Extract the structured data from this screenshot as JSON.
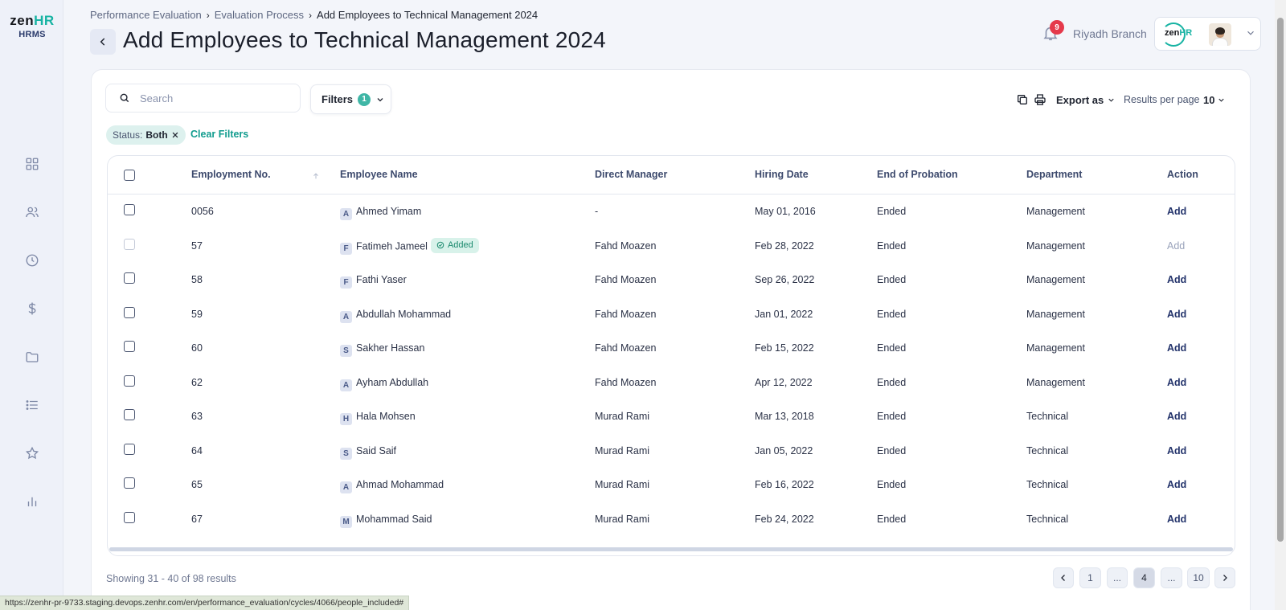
{
  "sidebar": {
    "logo_main": "zen",
    "logo_accent": "HR",
    "logo_sub": "HRMS",
    "nav_icons": [
      "dashboard-icon",
      "people-icon",
      "clock-icon",
      "dollar-icon",
      "folder-icon",
      "list-icon",
      "star-icon",
      "bar-chart-icon"
    ]
  },
  "header": {
    "breadcrumb": [
      "Performance Evaluation",
      "Evaluation Process",
      "Add Employees to Technical Management 2024"
    ],
    "title": "Add Employees to Technical Management 2024",
    "notification_count": "9",
    "branch": "Riyadh Branch",
    "company_logo_main": "zen",
    "company_logo_accent": "HR"
  },
  "toolbar": {
    "search_placeholder": "Search",
    "filters_label": "Filters",
    "filters_count": "1",
    "chip_label": "Status:",
    "chip_value": "Both",
    "clear_filters": "Clear Filters",
    "export_label": "Export as",
    "results_per_page_label": "Results per page",
    "results_per_page_value": "10"
  },
  "table": {
    "columns": [
      "Employment No.",
      "Employee Name",
      "Direct Manager",
      "Hiring Date",
      "End of Probation",
      "Department",
      "Action"
    ],
    "rows": [
      {
        "no": "0056",
        "initial": "A",
        "name": "Ahmed Yimam",
        "manager": "-",
        "hired": "May 01, 2016",
        "probation": "Ended",
        "dept": "Management",
        "action": "Add",
        "added": false
      },
      {
        "no": "57",
        "initial": "F",
        "name": "Fatimeh Jameel",
        "manager": "Fahd Moazen",
        "hired": "Feb 28, 2022",
        "probation": "Ended",
        "dept": "Management",
        "action": "Add",
        "added": true,
        "badge": "Added"
      },
      {
        "no": "58",
        "initial": "F",
        "name": "Fathi Yaser",
        "manager": "Fahd Moazen",
        "hired": "Sep 26, 2022",
        "probation": "Ended",
        "dept": "Management",
        "action": "Add",
        "added": false
      },
      {
        "no": "59",
        "initial": "A",
        "name": "Abdullah Mohammad",
        "manager": "Fahd Moazen",
        "hired": "Jan 01, 2022",
        "probation": "Ended",
        "dept": "Management",
        "action": "Add",
        "added": false
      },
      {
        "no": "60",
        "initial": "S",
        "name": "Sakher Hassan",
        "manager": "Fahd Moazen",
        "hired": "Feb 15, 2022",
        "probation": "Ended",
        "dept": "Management",
        "action": "Add",
        "added": false
      },
      {
        "no": "62",
        "initial": "A",
        "name": "Ayham Abdullah",
        "manager": "Fahd Moazen",
        "hired": "Apr 12, 2022",
        "probation": "Ended",
        "dept": "Management",
        "action": "Add",
        "added": false
      },
      {
        "no": "63",
        "initial": "H",
        "name": "Hala Mohsen",
        "manager": "Murad Rami",
        "hired": "Mar 13, 2018",
        "probation": "Ended",
        "dept": "Technical",
        "action": "Add",
        "added": false
      },
      {
        "no": "64",
        "initial": "S",
        "name": "Said Saif",
        "manager": "Murad Rami",
        "hired": "Jan 05, 2022",
        "probation": "Ended",
        "dept": "Technical",
        "action": "Add",
        "added": false
      },
      {
        "no": "65",
        "initial": "A",
        "name": "Ahmad Mohammad",
        "manager": "Murad Rami",
        "hired": "Feb 16, 2022",
        "probation": "Ended",
        "dept": "Technical",
        "action": "Add",
        "added": false
      },
      {
        "no": "67",
        "initial": "M",
        "name": "Mohammad Said",
        "manager": "Murad Rami",
        "hired": "Feb 24, 2022",
        "probation": "Ended",
        "dept": "Technical",
        "action": "Add",
        "added": false
      }
    ]
  },
  "footer": {
    "showing": "Showing 31 - 40 of 98 results",
    "pages": [
      "1",
      "...",
      "4",
      "...",
      "10"
    ],
    "current_page": "4"
  },
  "status_url": "https://zenhr-pr-9733.staging.devops.zenhr.com/en/performance_evaluation/cycles/4066/people_included#",
  "colors": {
    "accent": "#17b3a3",
    "primary_text": "#23336b",
    "badge_red": "#e5394b",
    "added_green": "#1b8a6e"
  }
}
